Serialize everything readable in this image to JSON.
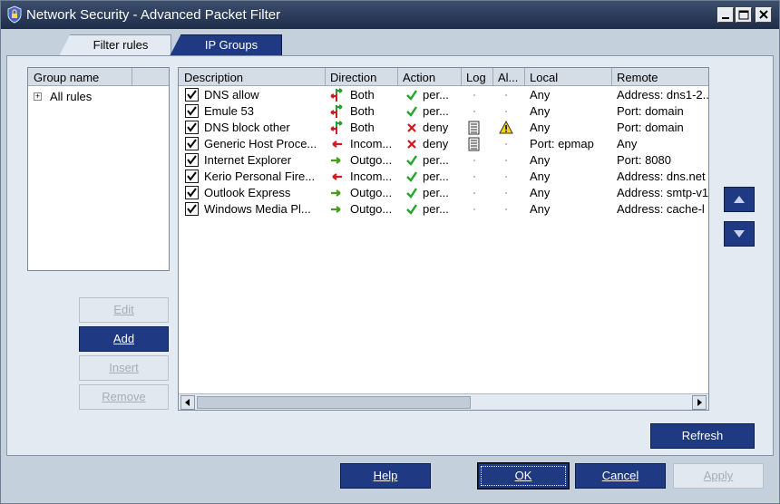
{
  "window": {
    "title": "Network Security - Advanced Packet Filter",
    "controls": [
      "minimize-icon",
      "maximize-icon",
      "close-icon"
    ]
  },
  "tabs": [
    {
      "label": "Filter rules",
      "active": true
    },
    {
      "label": "IP Groups",
      "active": false
    }
  ],
  "groups": {
    "header": "Group name",
    "items": [
      {
        "label": "All rules",
        "expander": "+"
      }
    ]
  },
  "left_buttons": {
    "edit": "Edit",
    "add": "Add",
    "insert": "Insert",
    "remove": "Remove"
  },
  "rules": {
    "columns": [
      "Description",
      "Direction",
      "Action",
      "Log",
      "Al...",
      "Local",
      "Remote"
    ],
    "rows": [
      {
        "checked": true,
        "description": "DNS allow",
        "direction": "Both",
        "direction_icon": "both-arrows-icon",
        "action": "per...",
        "action_icon": "check-icon",
        "log": "",
        "alert": "",
        "local": "Any",
        "remote": "Address: dns1-2..."
      },
      {
        "checked": true,
        "description": "Emule 53",
        "direction": "Both",
        "direction_icon": "both-arrows-icon",
        "action": "per...",
        "action_icon": "check-icon",
        "log": "",
        "alert": "",
        "local": "Any",
        "remote": "Port: domain"
      },
      {
        "checked": true,
        "description": "DNS block other",
        "direction": "Both",
        "direction_icon": "both-arrows-icon",
        "action": "deny",
        "action_icon": "x-icon",
        "log": "log-icon",
        "alert": "warning-icon",
        "local": "Any",
        "remote": "Port: domain"
      },
      {
        "checked": true,
        "description": "Generic Host Proce...",
        "direction": "Incom...",
        "direction_icon": "incoming-arrow-icon",
        "action": "deny",
        "action_icon": "x-icon",
        "log": "log-icon",
        "alert": "",
        "local": "Port: epmap",
        "remote": "Any"
      },
      {
        "checked": true,
        "description": "Internet Explorer",
        "direction": "Outgo...",
        "direction_icon": "outgoing-arrow-icon",
        "action": "per...",
        "action_icon": "check-icon",
        "log": "",
        "alert": "",
        "local": "Any",
        "remote": "Port: 8080"
      },
      {
        "checked": true,
        "description": "Kerio Personal Fire...",
        "direction": "Incom...",
        "direction_icon": "incoming-arrow-icon",
        "action": "per...",
        "action_icon": "check-icon",
        "log": "",
        "alert": "",
        "local": "Any",
        "remote": "Address: dns.net"
      },
      {
        "checked": true,
        "description": "Outlook Express",
        "direction": "Outgo...",
        "direction_icon": "outgoing-arrow-icon",
        "action": "per...",
        "action_icon": "check-icon",
        "log": "",
        "alert": "",
        "local": "Any",
        "remote": "Address: smtp-v1"
      },
      {
        "checked": true,
        "description": "Windows Media Pl...",
        "direction": "Outgo...",
        "direction_icon": "outgoing-arrow-icon",
        "action": "per...",
        "action_icon": "check-icon",
        "log": "",
        "alert": "",
        "local": "Any",
        "remote": "Address: cache-l"
      }
    ]
  },
  "side_controls": {
    "up": "move-up-icon",
    "down": "move-down-icon"
  },
  "refresh_label": "Refresh",
  "dialog_buttons": {
    "help": "Help",
    "ok": "OK",
    "cancel": "Cancel",
    "apply": "Apply"
  },
  "colors": {
    "title_bar": "#1e2c48",
    "accent_button": "#1f3a82",
    "panel": "#e4eaf1",
    "background": "#c4d0dc",
    "check_green": "#22a52a",
    "deny_red": "#d2141a"
  }
}
